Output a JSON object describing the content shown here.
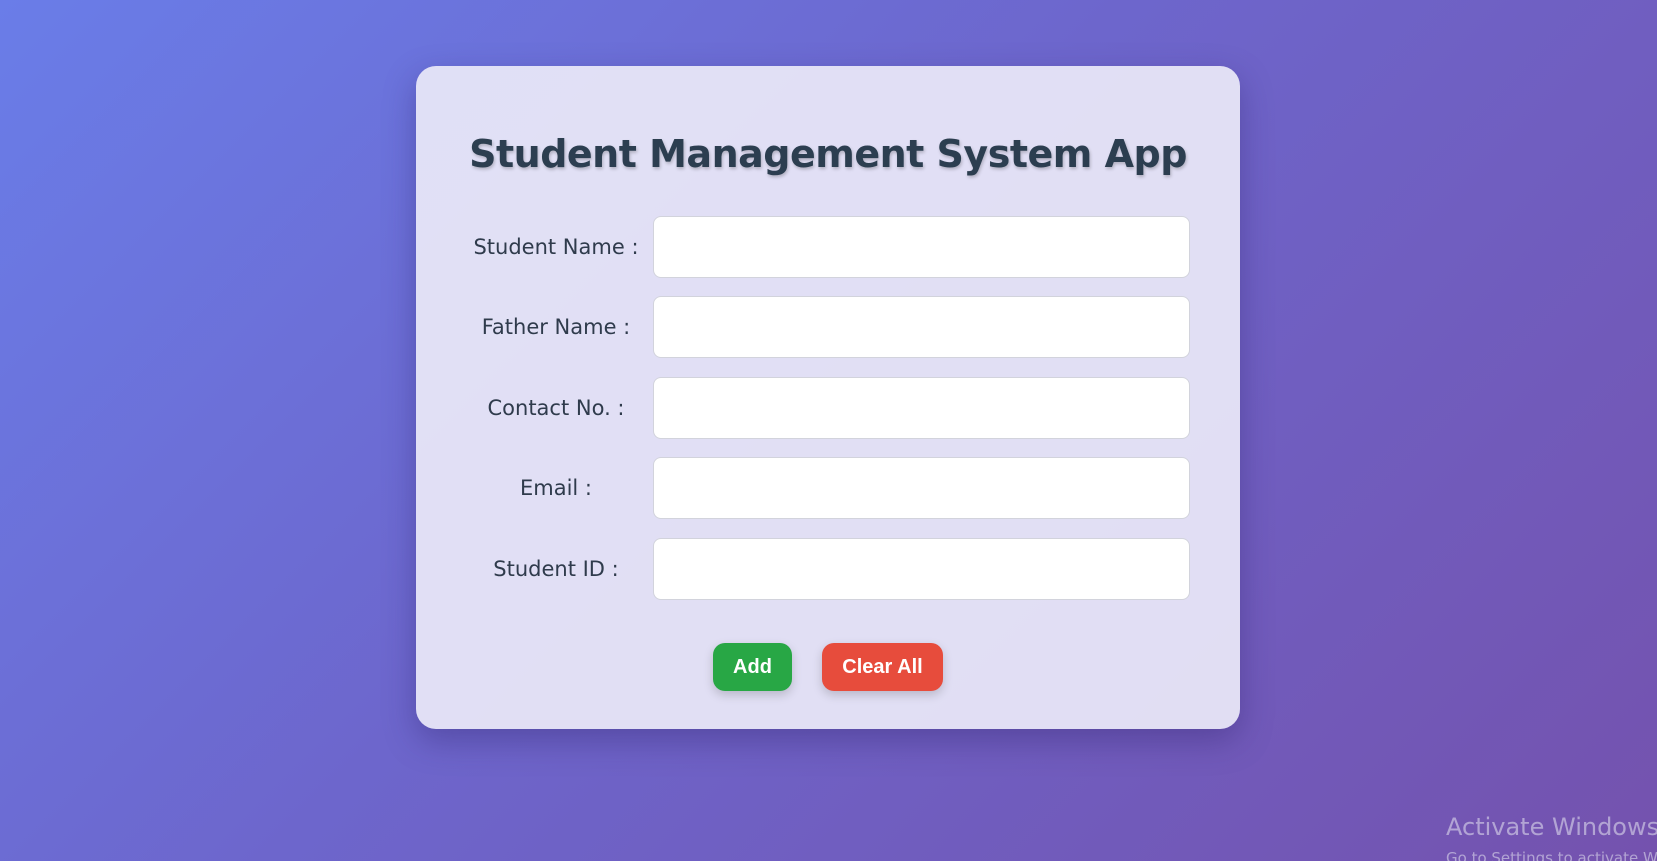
{
  "app": {
    "title": "Student Management System App"
  },
  "form": {
    "fields": [
      {
        "label": "Student Name :",
        "value": "",
        "placeholder": ""
      },
      {
        "label": "Father Name :",
        "value": "",
        "placeholder": ""
      },
      {
        "label": "Contact No. :",
        "value": "",
        "placeholder": ""
      },
      {
        "label": "Email :",
        "value": "",
        "placeholder": ""
      },
      {
        "label": "Student ID :",
        "value": "",
        "placeholder": ""
      }
    ]
  },
  "buttons": {
    "add_label": "Add",
    "clear_label": "Clear All"
  },
  "colors": {
    "add_button": "#28a745",
    "clear_button": "#e74c3c",
    "title_text": "#2c3e50",
    "background_start": "#6a7de8",
    "background_end": "#7452ae"
  },
  "watermark": {
    "title": "Activate Windows",
    "subtitle": "Go to Settings to activate Windows."
  }
}
